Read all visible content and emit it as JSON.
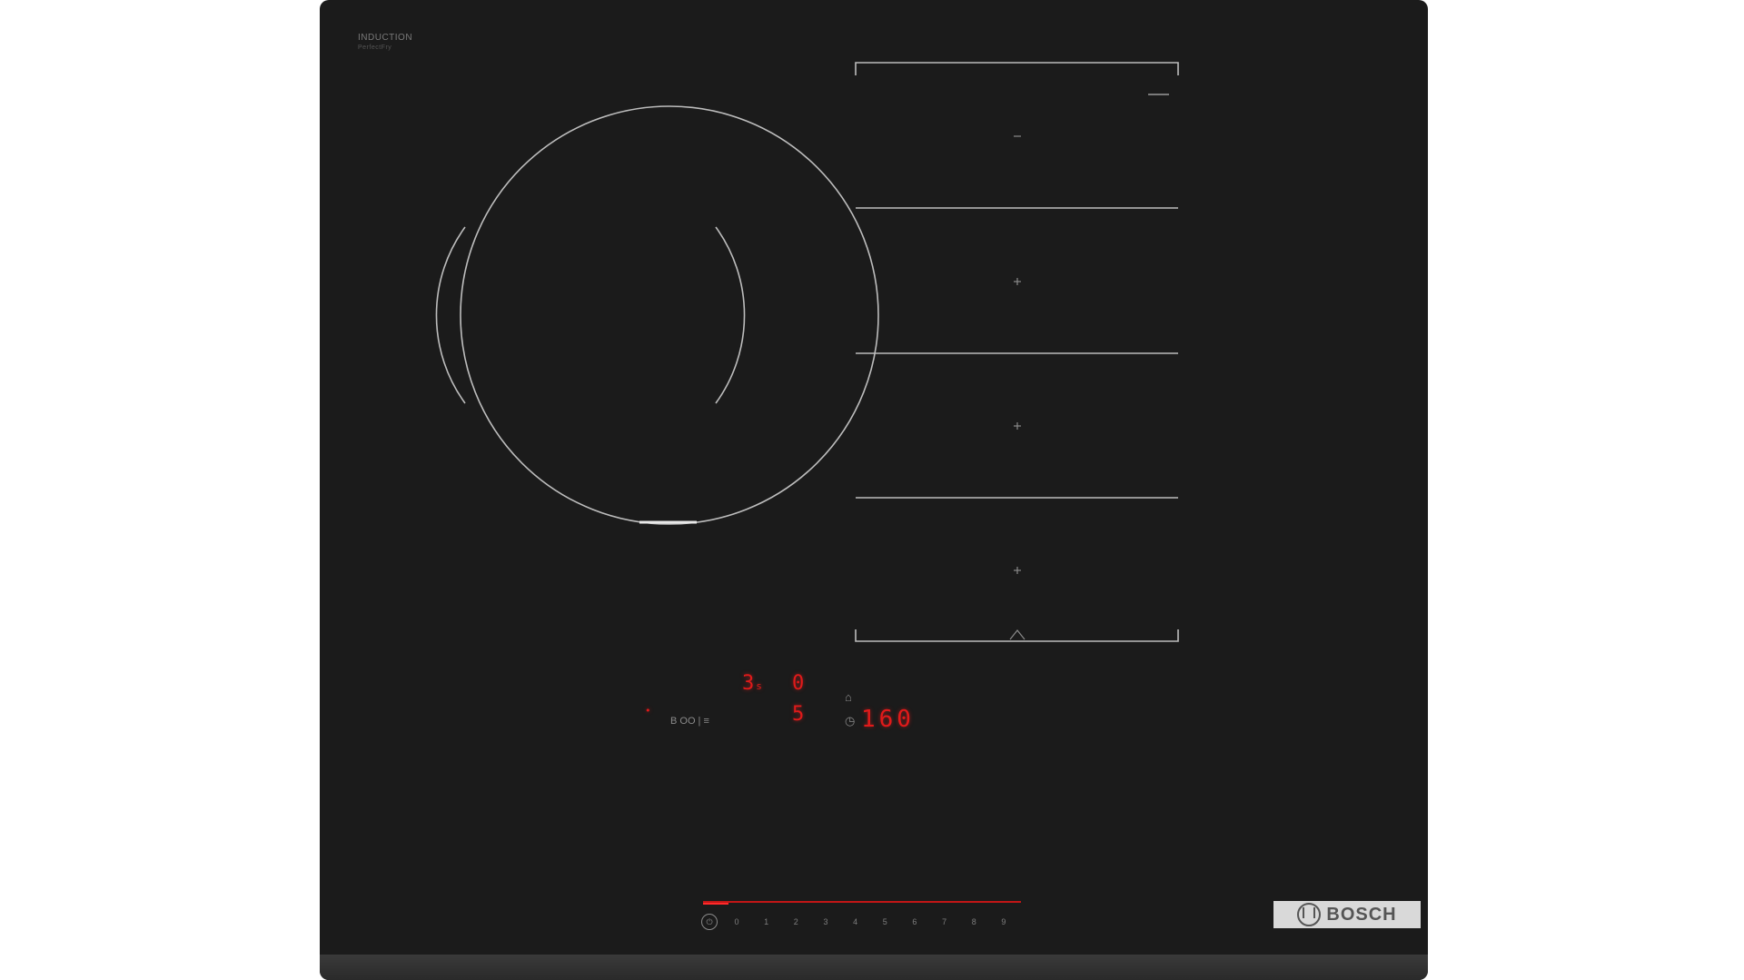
{
  "product": {
    "type_label": "INDUCTION",
    "type_sublabel": "PerfectFry",
    "brand": "BOSCH"
  },
  "control_panel": {
    "zone_level": "3",
    "zone_level_suffix": "s",
    "zone_display_2": "0",
    "timer_display": "160",
    "fry_level": "5",
    "power_icon": "power-icon",
    "mode_icons": [
      "frying-pan-icon",
      "timer-icon"
    ],
    "function_text": "B OO | ≡",
    "slider_steps": [
      "0",
      "1",
      "2",
      "3",
      "4",
      "5",
      "6",
      "7",
      "8",
      "9"
    ]
  },
  "colors": {
    "hob_surface": "#1b1b1b",
    "display_red": "#e01a1a",
    "marking_grey": "#bfbfbf",
    "badge_grey": "#d9d9d9"
  }
}
